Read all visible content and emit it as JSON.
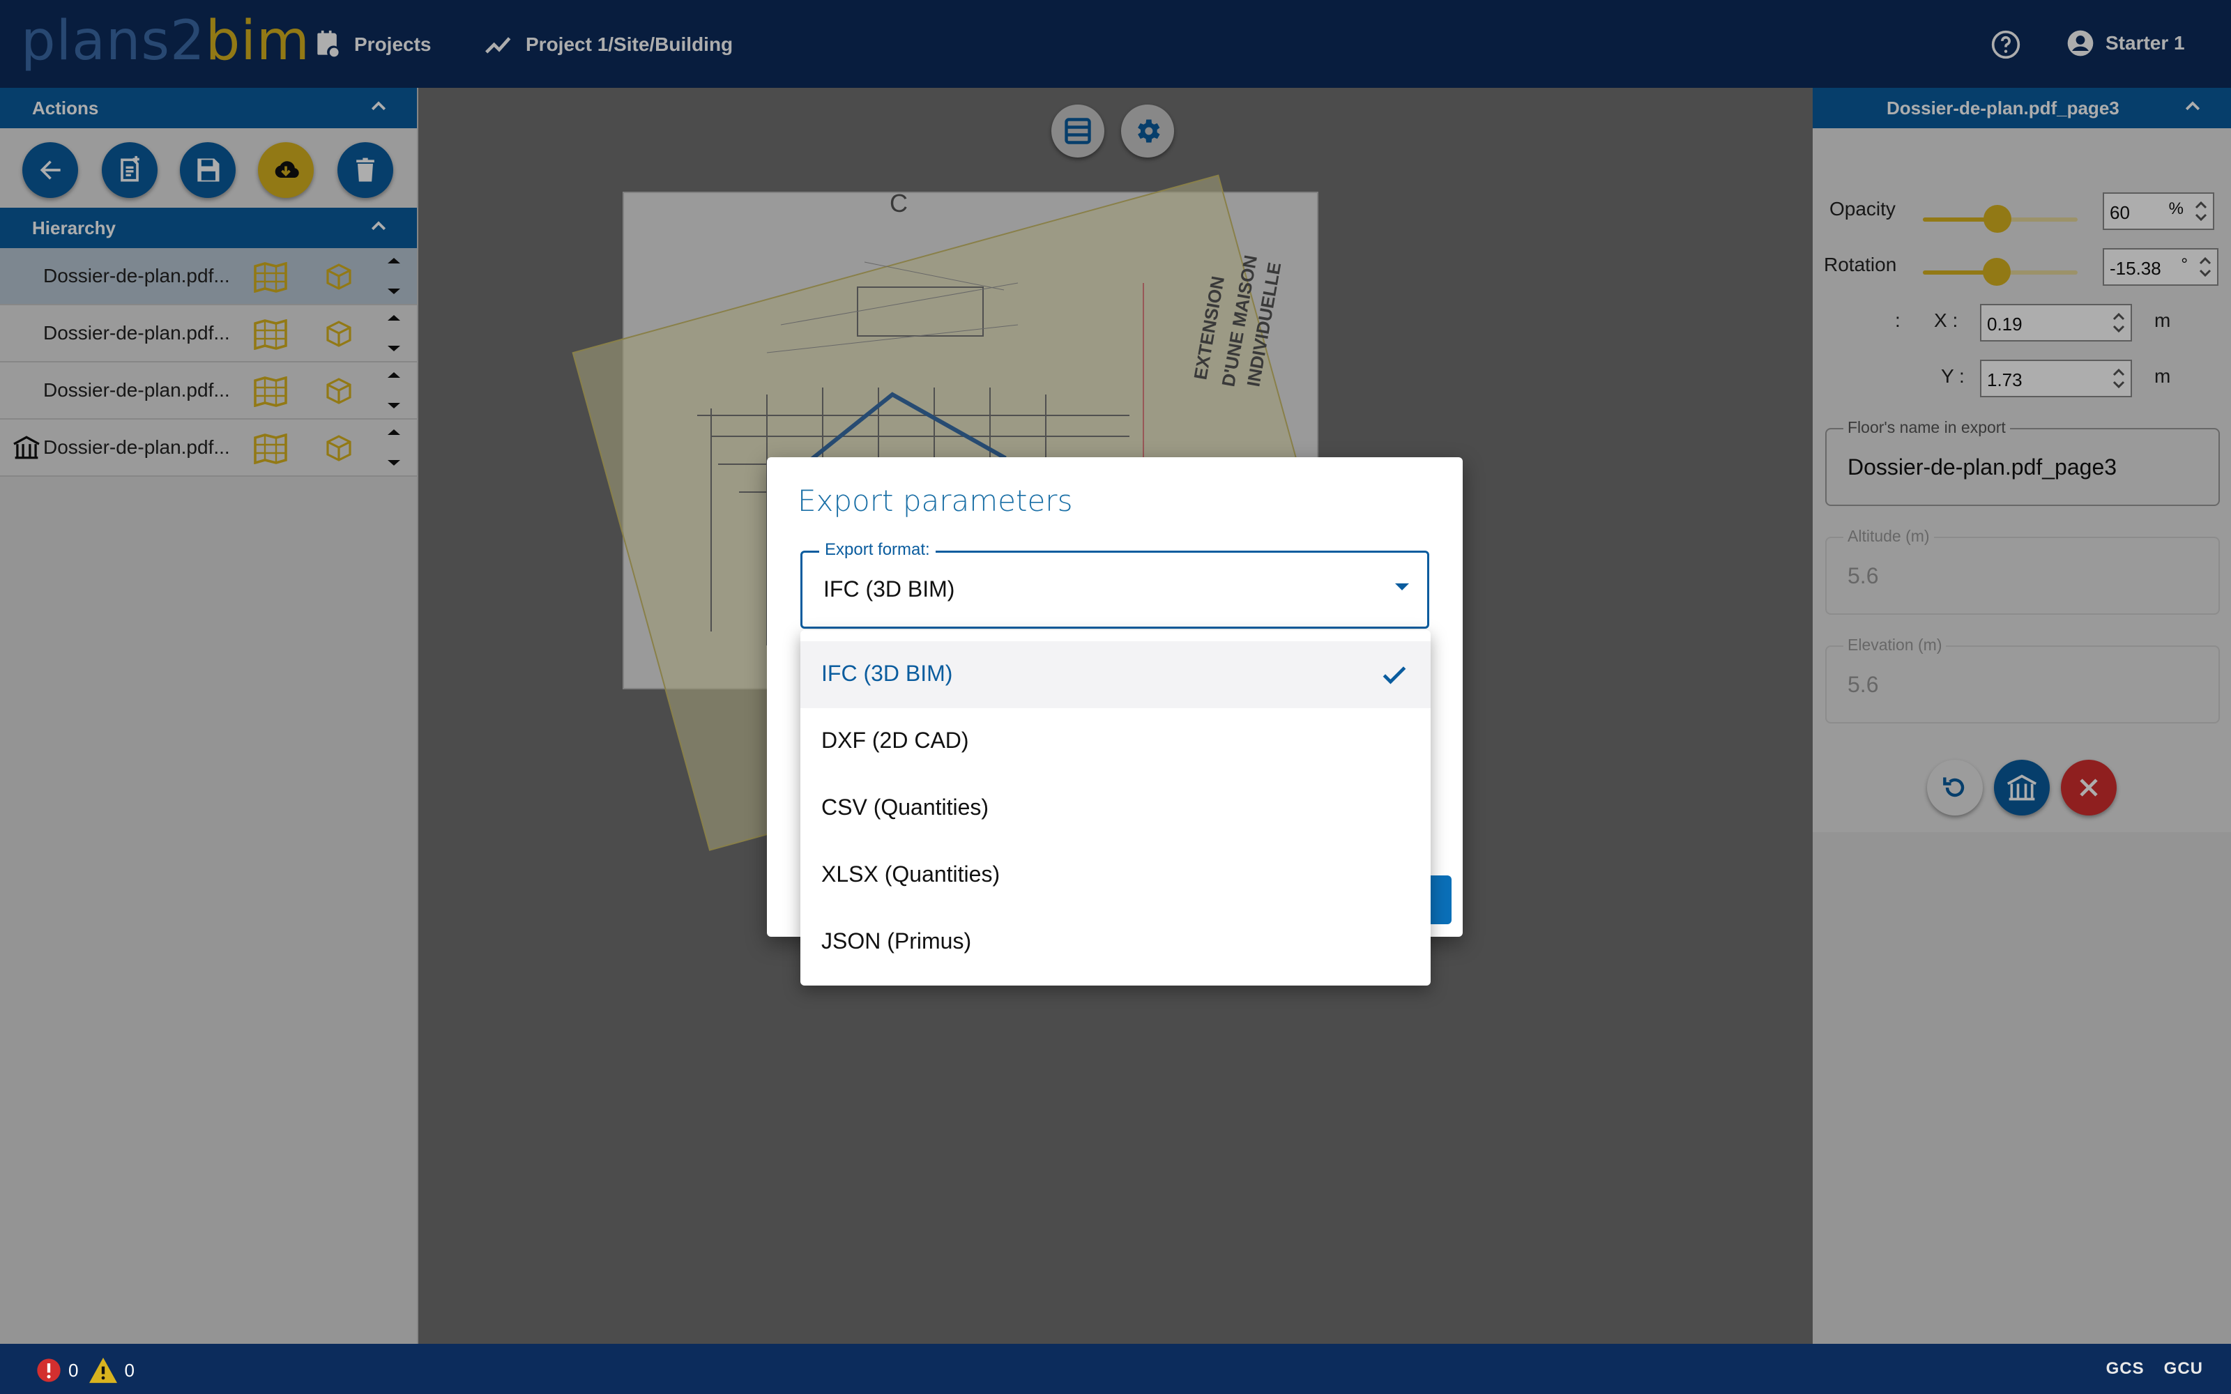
{
  "app": {
    "logo_main": "plans2",
    "logo_accent": "bim"
  },
  "header": {
    "nav": [
      {
        "label": "Projects",
        "icon": "notebook-icon"
      },
      {
        "label": "Project 1/Site/Building",
        "icon": "trend-line-icon"
      }
    ],
    "help_icon": "help-circle-icon",
    "user": {
      "label": "Starter 1",
      "icon": "account-circle-icon"
    }
  },
  "left_panel": {
    "actions": {
      "title": "Actions",
      "buttons": [
        {
          "name": "back",
          "icon": "arrow-left-icon"
        },
        {
          "name": "new-document",
          "icon": "document-plus-icon"
        },
        {
          "name": "save",
          "icon": "floppy-disk-icon"
        },
        {
          "name": "export",
          "icon": "cloud-download-icon"
        },
        {
          "name": "delete",
          "icon": "trash-icon"
        }
      ]
    },
    "hierarchy": {
      "title": "Hierarchy",
      "items": [
        {
          "label": "Dossier-de-plan.pdf...",
          "selected": true
        },
        {
          "label": "Dossier-de-plan.pdf...",
          "selected": false
        },
        {
          "label": "Dossier-de-plan.pdf...",
          "selected": false
        },
        {
          "label": "Dossier-de-plan.pdf...",
          "selected": false,
          "building_marker": true
        }
      ]
    }
  },
  "canvas": {
    "toolbar": [
      {
        "name": "layers",
        "icon": "layers-icon"
      },
      {
        "name": "settings",
        "icon": "gear-icon"
      }
    ]
  },
  "right_panel": {
    "title": "Dossier-de-plan.pdf_page3",
    "opacity": {
      "label": "Opacity",
      "value": "60",
      "unit": "%",
      "level": 0.6
    },
    "rotation": {
      "label": "Rotation",
      "value": "-15.38",
      "unit": "°"
    },
    "position": {
      "prefix": ":",
      "x": {
        "label": "X :",
        "value": "0.19",
        "unit": "m"
      },
      "y": {
        "label": "Y :",
        "value": "1.73",
        "unit": "m"
      }
    },
    "floor_name": {
      "label": "Floor's name in export",
      "value": "Dossier-de-plan.pdf_page3"
    },
    "altitude": {
      "label": "Altitude (m)",
      "value": "5.6"
    },
    "elevation": {
      "label": "Elevation (m)",
      "value": "5.6"
    },
    "actions": [
      {
        "name": "reset",
        "icon": "refresh-icon"
      },
      {
        "name": "building",
        "icon": "building-icon"
      },
      {
        "name": "close",
        "icon": "close-icon"
      }
    ]
  },
  "dialog": {
    "title": "Export parameters",
    "format_field": {
      "label": "Export format:",
      "value": "IFC (3D BIM)"
    },
    "options": [
      {
        "label": "IFC (3D BIM)",
        "selected": true
      },
      {
        "label": "DXF (2D CAD)",
        "selected": false
      },
      {
        "label": "CSV (Quantities)",
        "selected": false
      },
      {
        "label": "XLSX (Quantities)",
        "selected": false
      },
      {
        "label": "JSON (Primus)",
        "selected": false
      }
    ]
  },
  "footer": {
    "errors": "0",
    "warnings": "0",
    "tags": [
      "GCS",
      "GCU"
    ]
  },
  "colors": {
    "header_bg": "#0c2c5c",
    "primary": "#0a5c9e",
    "accent": "#d8b31f",
    "danger": "#d32f2f"
  }
}
